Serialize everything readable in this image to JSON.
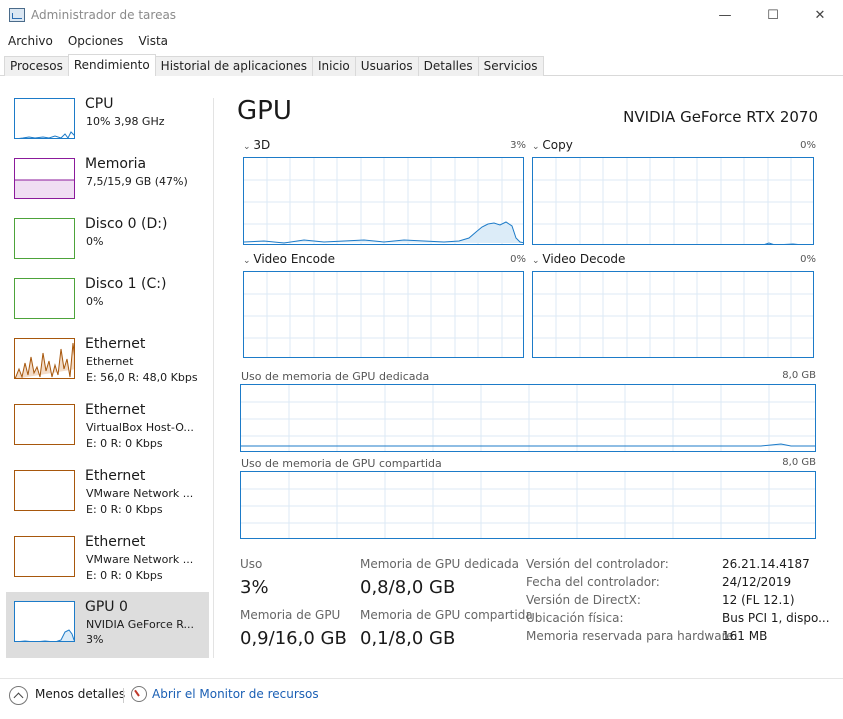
{
  "window": {
    "title": "Administrador de tareas",
    "app_icon": "task-manager-icon",
    "controls": {
      "minimize": "—",
      "maximize": "☐",
      "close": "✕"
    }
  },
  "menu": [
    "Archivo",
    "Opciones",
    "Vista"
  ],
  "tabs": [
    "Procesos",
    "Rendimiento",
    "Historial de aplicaciones",
    "Inicio",
    "Usuarios",
    "Detalles",
    "Servicios"
  ],
  "active_tab": "Rendimiento",
  "sidebar": {
    "items": [
      {
        "title": "CPU",
        "line1": "10%  3,98 GHz",
        "line2": "",
        "color": "#1d7bc8"
      },
      {
        "title": "Memoria",
        "line1": "7,5/15,9 GB (47%)",
        "line2": "",
        "color": "#8b1a9b"
      },
      {
        "title": "Disco 0 (D:)",
        "line1": "0%",
        "line2": "",
        "color": "#4da33a"
      },
      {
        "title": "Disco 1 (C:)",
        "line1": "0%",
        "line2": "",
        "color": "#4da33a"
      },
      {
        "title": "Ethernet",
        "line1": "Ethernet",
        "line2": "E: 56,0  R: 48,0 Kbps",
        "color": "#a7570c"
      },
      {
        "title": "Ethernet",
        "line1": "VirtualBox Host-O...",
        "line2": "E: 0  R: 0 Kbps",
        "color": "#a7570c"
      },
      {
        "title": "Ethernet",
        "line1": "VMware Network ...",
        "line2": "E: 0  R: 0 Kbps",
        "color": "#a7570c"
      },
      {
        "title": "Ethernet",
        "line1": "VMware Network ...",
        "line2": "E: 0  R: 0 Kbps",
        "color": "#a7570c"
      },
      {
        "title": "GPU 0",
        "line1": "NVIDIA GeForce R...",
        "line2": "3%",
        "color": "#1d7bc8"
      }
    ]
  },
  "main": {
    "title": "GPU",
    "device": "NVIDIA GeForce RTX 2070",
    "graphs": [
      {
        "label": "3D",
        "pct": "3%"
      },
      {
        "label": "Copy",
        "pct": "0%"
      },
      {
        "label": "Video Encode",
        "pct": "0%"
      },
      {
        "label": "Video Decode",
        "pct": "0%"
      }
    ],
    "dedicated_mem": {
      "label": "Uso de memoria de GPU dedicada",
      "max": "8,0 GB"
    },
    "shared_mem": {
      "label": "Uso de memoria de GPU compartida",
      "max": "8,0 GB"
    },
    "stats": {
      "uso_label": "Uso",
      "uso_value": "3%",
      "mem_ded_label": "Memoria de GPU dedicada",
      "mem_ded_value": "0,8/8,0 GB",
      "mem_gpu_label": "Memoria de GPU",
      "mem_gpu_value": "0,9/16,0 GB",
      "mem_comp_label": "Memoria de GPU compartida",
      "mem_comp_value": "0,1/8,0 GB"
    },
    "info": [
      {
        "label": "Versión del controlador:",
        "value": "26.21.14.4187"
      },
      {
        "label": "Fecha del controlador:",
        "value": "24/12/2019"
      },
      {
        "label": "Versión de DirectX:",
        "value": "12 (FL 12.1)"
      },
      {
        "label": "Ubicación física:",
        "value": "Bus PCI 1, dispo..."
      },
      {
        "label": "Memoria reservada para hardware:",
        "value": "161 MB"
      }
    ]
  },
  "footer": {
    "less_details": "Menos detalles",
    "monitor_link": "Abrir el Monitor de recursos"
  },
  "colors": {
    "accent": "#1d7bc8",
    "selected_bg": "#dddddd",
    "grid": "#d8eaf6"
  }
}
